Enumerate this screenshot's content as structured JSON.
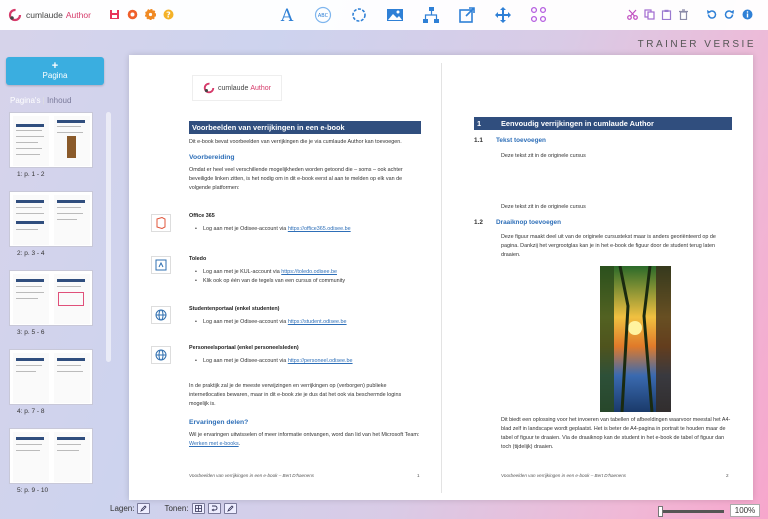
{
  "app": {
    "name": "cumlaude",
    "name_accent": "Author",
    "mode": "TRAINER VERSIE"
  },
  "toolbar": {
    "left_icons": [
      "save-icon",
      "preview-icon",
      "settings-icon",
      "help-icon"
    ],
    "mid_icons": [
      "text-style-icon",
      "abc-icon",
      "refresh-icon",
      "image-icon",
      "flowchart-icon",
      "external-link-icon",
      "move-icon",
      "grid-icon"
    ],
    "right_icons": [
      "cut-icon",
      "copy-icon",
      "paste-icon",
      "delete-icon",
      "undo-icon",
      "redo-icon",
      "info-icon"
    ]
  },
  "sidebar": {
    "add_page_label": "Pagina",
    "tab_pages": "Pagina's",
    "tab_separator": "|",
    "tab_content": "Inhoud",
    "thumbnails": [
      {
        "label": "1: p. 1 - 2"
      },
      {
        "label": "2: p. 3 - 4"
      },
      {
        "label": "3: p. 5 - 6"
      },
      {
        "label": "4: p. 7 - 8"
      },
      {
        "label": "5: p. 9 - 10"
      }
    ]
  },
  "page1": {
    "logo_text": "cumlaude",
    "logo_accent": "Author",
    "title": "Voorbeelden van verrijkingen in een e-book",
    "intro": "Dit e-book bevat voorbeelden van verrijkingen die je via cumlaude Author kan toevoegen.",
    "h_prep": "Voorbereiding",
    "prep_text": "Omdat er heel veel verschillende mogelijkheden worden getoond die – soms – ook achter beveiligde linken zitten, is het nodig om in dit e-book eerst al aan te melden op elk van de volgende platformen:",
    "platforms": [
      {
        "name": "Office 365",
        "icon": "office-icon",
        "items": [
          {
            "text": "Log aan met je Odisee-account via ",
            "link": "https://office365.odisee.be"
          }
        ]
      },
      {
        "name": "Toledo",
        "icon": "toledo-icon",
        "items": [
          {
            "text": "Log aan met je KUL-account via ",
            "link": "https://toledo.odisee.be"
          },
          {
            "text": "Klik ook op één van de tegels van een cursus of community",
            "link": ""
          }
        ]
      },
      {
        "name": "Studentenportaal (enkel studenten)",
        "icon": "globe-icon",
        "items": [
          {
            "text": "Log aan met je Odisee-account via ",
            "link": "https://student.odisee.be"
          }
        ]
      },
      {
        "name": "Personeelsportaal (enkel personeelsleden)",
        "icon": "globe-icon",
        "items": [
          {
            "text": "Log aan met je Odisee-account via ",
            "link": "https://personeel.odisee.be"
          }
        ]
      }
    ],
    "practice_text": "In de praktijk zal je de meeste verwijzingen en verrijkingen op (verborgen) publieke internetlocaties bewaren, maar in dit e-book zie je dus dat het ook via beschermde logins mogelijk is.",
    "h_share": "Ervaringen delen?",
    "share_text": "Wil je ervaringen uitwisselen of meer informatie ontvangen, word dan lid van het Microsoft Team: ",
    "share_link": "Werken met e-books",
    "share_end": ".",
    "footer": "Voorbeelden van verrijkingen in een e-book – Bert D'haenens",
    "page_num": "1"
  },
  "page2": {
    "sec_num": "1",
    "sec_title": "Eenvoudig verrijkingen in cumlaude Author",
    "sub1_num": "1.1",
    "sub1_title": "Tekst toevoegen",
    "text_orig": "Deze tekst zit in de originele cursus",
    "text_added": "Deze tekst zit in de originele cursus",
    "sub2_num": "1.2",
    "sub2_title": "Draaiknop toevoegen",
    "rotate_text": "Deze figuur maakt deel uit van de originele cursustekst maar is anders georiënteerd op de pagina. Dankzij het vergrootglas kan je in het e-book de figuur door de student terug laten draaien.",
    "solution_text": "Dit biedt een oplossing voor het invoeren van tabellen of afbeeldingen waarvoor meestal het A4-blad zelf in landscape wordt geplaatst. Het is beter de A4-pagina in portrait te houden maar de tabel of figuur te draaien. Via de draaiknop kan de student in het e-book de tabel of figuur dan toch (tijdelijk) draaien.",
    "footer": "Voorbeelden van verrijkingen in een e-book – Bert D'haenens",
    "page_num": "2"
  },
  "bottom": {
    "layers_label": "Lagen:",
    "tones_label": "Tonen:",
    "zoom": "100%"
  },
  "colors": {
    "accent": "#d63a6a",
    "heading_bar": "#304e7e",
    "link": "#2e6fb8",
    "add_button": "#3aaee0"
  }
}
